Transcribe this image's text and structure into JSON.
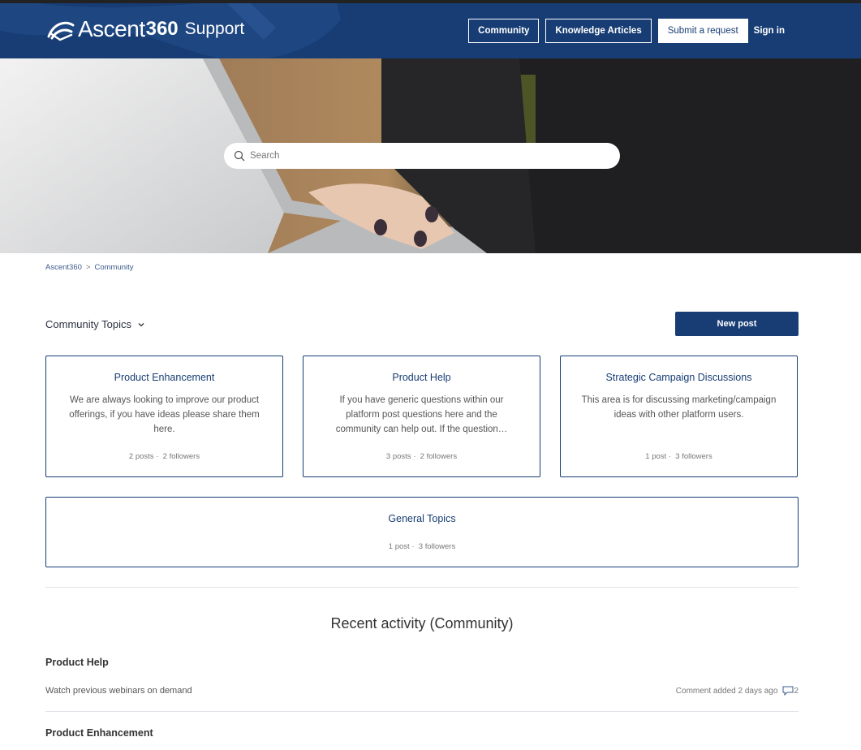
{
  "header": {
    "brand_name": "Ascent",
    "brand_number": "360",
    "brand_suffix": "Support",
    "nav": {
      "community": "Community",
      "knowledge": "Knowledge Articles",
      "submit": "Submit a request",
      "signin": "Sign in"
    }
  },
  "search": {
    "placeholder": "Search"
  },
  "breadcrumb": {
    "home": "Ascent360",
    "sep": ">",
    "current": "Community"
  },
  "topics": {
    "heading": "Community Topics",
    "new_post": "New post",
    "cards": [
      {
        "title": "Product Enhancement",
        "desc": "We are always looking to improve our product offerings, if you have ideas please share them here.",
        "posts": "2 posts",
        "followers": "2 followers"
      },
      {
        "title": "Product Help",
        "desc": "If you have generic questions within our platform post questions here and the community can help out. If the question…",
        "posts": "3 posts",
        "followers": "2 followers"
      },
      {
        "title": "Strategic Campaign Discussions",
        "desc": "This area is for discussing marketing/campaign ideas with other platform users.",
        "posts": "1 post",
        "followers": "3 followers"
      },
      {
        "title": "General Topics",
        "desc": "",
        "posts": "1 post",
        "followers": "3 followers"
      }
    ]
  },
  "recent": {
    "title": "Recent activity (Community)",
    "items": [
      {
        "topic": "Product Help",
        "post": "Watch previous webinars on demand",
        "meta": "Comment added 2 days ago",
        "comments": "2"
      },
      {
        "topic": "Product Enhancement"
      }
    ]
  },
  "colors": {
    "brand": "#173d74",
    "border": "#173d74",
    "divider": "#dfe2e6"
  },
  "icons": [
    "ascent-logo-icon",
    "search-icon",
    "chevron-down-icon",
    "comment-icon"
  ]
}
